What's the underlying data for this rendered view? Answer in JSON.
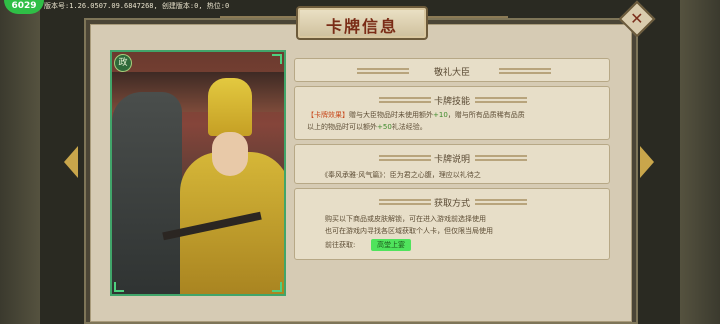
{
  "hud": {
    "fps": "6029",
    "version": "版本号:1.26.0507.09.6847268, 创建版本:0, 热位:0"
  },
  "dialog": {
    "title": "卡牌信息",
    "close_label": "✕"
  },
  "card": {
    "badge": "政"
  },
  "sections": {
    "name": {
      "title": "敬礼大臣"
    },
    "skill": {
      "title": "卡牌技能",
      "tag": "【卡牌效果】",
      "line1a": "赠与大臣物品时未使用额外",
      "line1b": "+10",
      "line1c": "，赠与所有品质稀有品质",
      "line2a": "以上的物品时可以额外",
      "line2b": "+50",
      "line2c": "礼法经验。"
    },
    "desc": {
      "title": "卡牌说明",
      "text": "《奉风承雅·风气篇》：臣为君之心腹，理应以礼待之"
    },
    "source": {
      "title": "获取方式",
      "line1": "购买以下商品或皮肤解锁，可在进入游戏前选择使用",
      "line2": "也可在游戏内寻找各区域获取个人卡，但仅限当局使用",
      "goto_label": "前往获取:",
      "goto_button": "高堂上宴"
    }
  }
}
